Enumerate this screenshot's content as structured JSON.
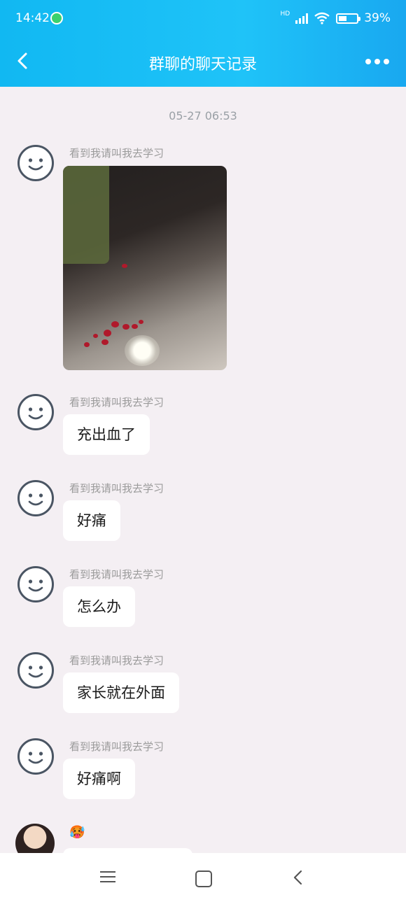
{
  "status_bar": {
    "time": "14:42",
    "network": "HD",
    "battery": "39%"
  },
  "nav": {
    "title": "群聊的聊天记录"
  },
  "chat": {
    "timestamp": "05-27 06:53",
    "sender_name": "看到我请叫我去学习",
    "messages": [
      {
        "text": "充出血了"
      },
      {
        "text": "好痛"
      },
      {
        "text": "怎么办"
      },
      {
        "text": "家长就在外面"
      },
      {
        "text": "好痛啊"
      }
    ],
    "last_sender_emoji": "🥵"
  },
  "colors": {
    "header": "#1fc3f8",
    "background": "#f4eff3"
  }
}
